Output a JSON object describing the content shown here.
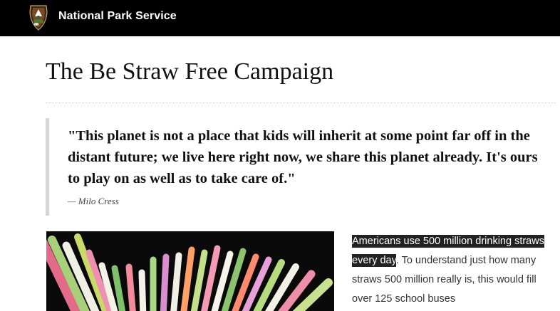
{
  "header": {
    "site_name": "National Park Service",
    "logo_icon": "nps-arrowhead-icon",
    "background": "#000000"
  },
  "main": {
    "title": "The Be Straw Free Campaign",
    "quote": {
      "text": "\"This planet is not a place that kids will inherit at some point far off in the distant future; we live here right now, we share this planet already. It's ours to play on as well as to take care of.\"",
      "attribution": "— Milo Cress"
    },
    "image": {
      "subject": "drinking-straws-photo"
    },
    "body": {
      "highlight": "Americans use 500 million drinking straws every day",
      "text": ". To understand just how many straws 500 million really is, this would fill over 125 school buses"
    }
  }
}
